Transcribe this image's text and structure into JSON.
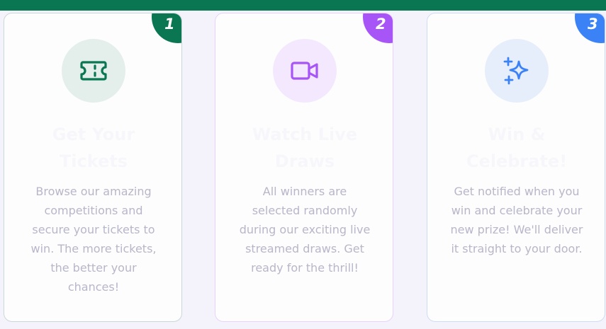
{
  "colors": {
    "top_bar": "#0a7652",
    "step1": "#0a7652",
    "step2": "#a855f7",
    "step3": "#3b82f6",
    "step1_icon_bg": "#e4efec",
    "step2_icon_bg": "#f3e8fd",
    "step3_icon_bg": "#e6edfb"
  },
  "steps": [
    {
      "number": "1",
      "icon": "ticket-icon",
      "title_line1": "Get Your",
      "title_line2": "Tickets",
      "description": "Browse our amazing competitions and secure your tickets to win. The more tickets, the better your chances!"
    },
    {
      "number": "2",
      "icon": "video-icon",
      "title_line1": "Watch Live",
      "title_line2": "Draws",
      "description": "All winners are selected randomly during our exciting live streamed draws. Get ready for the thrill!"
    },
    {
      "number": "3",
      "icon": "sparkles-icon",
      "title_line1": "Win &",
      "title_line2": "Celebrate!",
      "description": "Get notified when you win and celebrate your new prize! We'll deliver it straight to your door."
    }
  ]
}
